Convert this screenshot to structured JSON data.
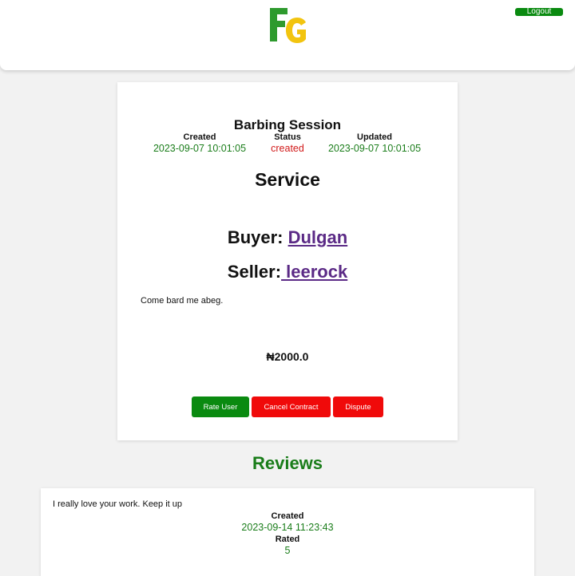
{
  "header": {
    "logo_text": "FG",
    "logout_label": "Logout"
  },
  "session": {
    "title": "Barbing Session",
    "created_label": "Created",
    "created_value": "2023-09-07 10:01:05",
    "status_label": "Status",
    "status_value": "created",
    "updated_label": "Updated",
    "updated_value": "2023-09-07 10:01:05",
    "service_heading": "Service",
    "buyer_label": "Buyer: ",
    "buyer_name": "Dulgan",
    "seller_label": "Seller:",
    "seller_name": " leerock",
    "description": "Come bard me abeg.",
    "price": "₦2000.0"
  },
  "actions": {
    "rate_label": "Rate User",
    "cancel_label": "Cancel Contract",
    "dispute_label": "Dispute"
  },
  "reviews": {
    "heading": "Reviews",
    "items": [
      {
        "text": "I really love your work. Keep it up",
        "created_label": "Created",
        "created_value": "2023-09-14 11:23:43",
        "rated_label": "Rated",
        "rated_value": "5"
      }
    ]
  },
  "colors": {
    "brand_green": "#0a8a10",
    "danger_red": "#f00a0a",
    "link_purple": "#5b2a86",
    "logo_yellow": "#f2c40f"
  }
}
